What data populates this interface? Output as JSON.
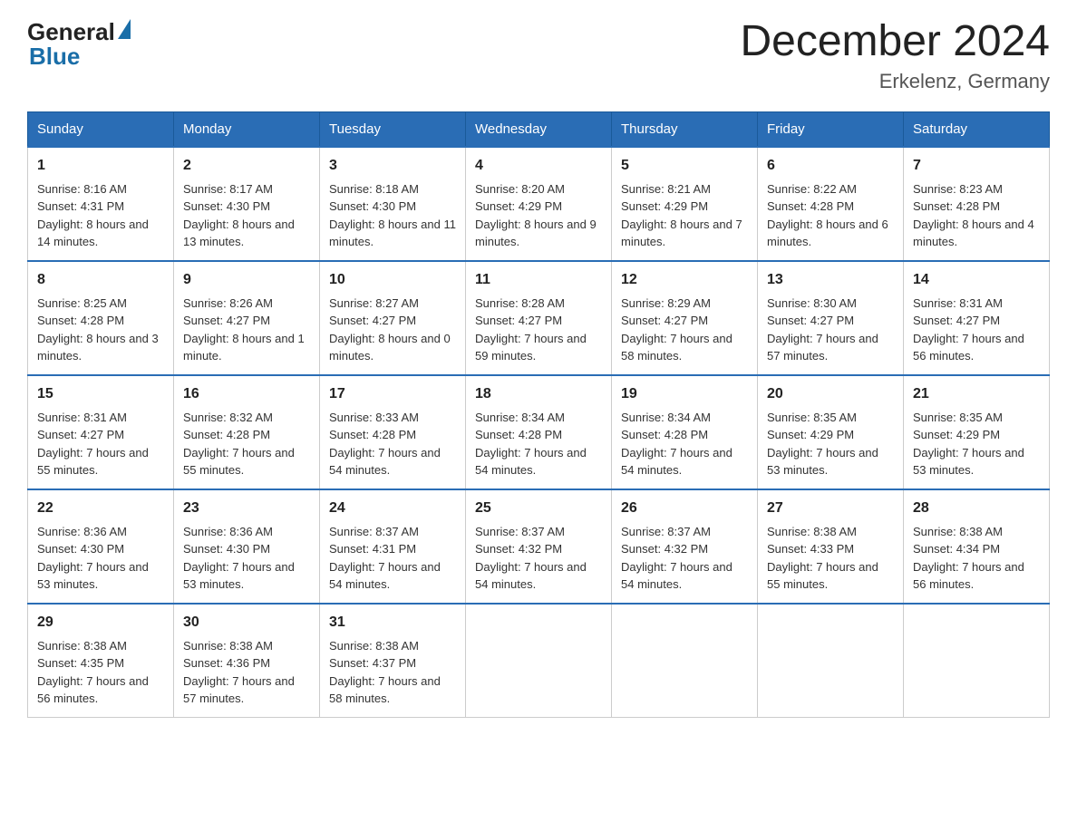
{
  "header": {
    "logo_general": "General",
    "logo_blue": "Blue",
    "title": "December 2024",
    "location": "Erkelenz, Germany"
  },
  "days_of_week": [
    "Sunday",
    "Monday",
    "Tuesday",
    "Wednesday",
    "Thursday",
    "Friday",
    "Saturday"
  ],
  "weeks": [
    [
      {
        "day": "1",
        "sunrise": "8:16 AM",
        "sunset": "4:31 PM",
        "daylight": "8 hours and 14 minutes."
      },
      {
        "day": "2",
        "sunrise": "8:17 AM",
        "sunset": "4:30 PM",
        "daylight": "8 hours and 13 minutes."
      },
      {
        "day": "3",
        "sunrise": "8:18 AM",
        "sunset": "4:30 PM",
        "daylight": "8 hours and 11 minutes."
      },
      {
        "day": "4",
        "sunrise": "8:20 AM",
        "sunset": "4:29 PM",
        "daylight": "8 hours and 9 minutes."
      },
      {
        "day": "5",
        "sunrise": "8:21 AM",
        "sunset": "4:29 PM",
        "daylight": "8 hours and 7 minutes."
      },
      {
        "day": "6",
        "sunrise": "8:22 AM",
        "sunset": "4:28 PM",
        "daylight": "8 hours and 6 minutes."
      },
      {
        "day": "7",
        "sunrise": "8:23 AM",
        "sunset": "4:28 PM",
        "daylight": "8 hours and 4 minutes."
      }
    ],
    [
      {
        "day": "8",
        "sunrise": "8:25 AM",
        "sunset": "4:28 PM",
        "daylight": "8 hours and 3 minutes."
      },
      {
        "day": "9",
        "sunrise": "8:26 AM",
        "sunset": "4:27 PM",
        "daylight": "8 hours and 1 minute."
      },
      {
        "day": "10",
        "sunrise": "8:27 AM",
        "sunset": "4:27 PM",
        "daylight": "8 hours and 0 minutes."
      },
      {
        "day": "11",
        "sunrise": "8:28 AM",
        "sunset": "4:27 PM",
        "daylight": "7 hours and 59 minutes."
      },
      {
        "day": "12",
        "sunrise": "8:29 AM",
        "sunset": "4:27 PM",
        "daylight": "7 hours and 58 minutes."
      },
      {
        "day": "13",
        "sunrise": "8:30 AM",
        "sunset": "4:27 PM",
        "daylight": "7 hours and 57 minutes."
      },
      {
        "day": "14",
        "sunrise": "8:31 AM",
        "sunset": "4:27 PM",
        "daylight": "7 hours and 56 minutes."
      }
    ],
    [
      {
        "day": "15",
        "sunrise": "8:31 AM",
        "sunset": "4:27 PM",
        "daylight": "7 hours and 55 minutes."
      },
      {
        "day": "16",
        "sunrise": "8:32 AM",
        "sunset": "4:28 PM",
        "daylight": "7 hours and 55 minutes."
      },
      {
        "day": "17",
        "sunrise": "8:33 AM",
        "sunset": "4:28 PM",
        "daylight": "7 hours and 54 minutes."
      },
      {
        "day": "18",
        "sunrise": "8:34 AM",
        "sunset": "4:28 PM",
        "daylight": "7 hours and 54 minutes."
      },
      {
        "day": "19",
        "sunrise": "8:34 AM",
        "sunset": "4:28 PM",
        "daylight": "7 hours and 54 minutes."
      },
      {
        "day": "20",
        "sunrise": "8:35 AM",
        "sunset": "4:29 PM",
        "daylight": "7 hours and 53 minutes."
      },
      {
        "day": "21",
        "sunrise": "8:35 AM",
        "sunset": "4:29 PM",
        "daylight": "7 hours and 53 minutes."
      }
    ],
    [
      {
        "day": "22",
        "sunrise": "8:36 AM",
        "sunset": "4:30 PM",
        "daylight": "7 hours and 53 minutes."
      },
      {
        "day": "23",
        "sunrise": "8:36 AM",
        "sunset": "4:30 PM",
        "daylight": "7 hours and 53 minutes."
      },
      {
        "day": "24",
        "sunrise": "8:37 AM",
        "sunset": "4:31 PM",
        "daylight": "7 hours and 54 minutes."
      },
      {
        "day": "25",
        "sunrise": "8:37 AM",
        "sunset": "4:32 PM",
        "daylight": "7 hours and 54 minutes."
      },
      {
        "day": "26",
        "sunrise": "8:37 AM",
        "sunset": "4:32 PM",
        "daylight": "7 hours and 54 minutes."
      },
      {
        "day": "27",
        "sunrise": "8:38 AM",
        "sunset": "4:33 PM",
        "daylight": "7 hours and 55 minutes."
      },
      {
        "day": "28",
        "sunrise": "8:38 AM",
        "sunset": "4:34 PM",
        "daylight": "7 hours and 56 minutes."
      }
    ],
    [
      {
        "day": "29",
        "sunrise": "8:38 AM",
        "sunset": "4:35 PM",
        "daylight": "7 hours and 56 minutes."
      },
      {
        "day": "30",
        "sunrise": "8:38 AM",
        "sunset": "4:36 PM",
        "daylight": "7 hours and 57 minutes."
      },
      {
        "day": "31",
        "sunrise": "8:38 AM",
        "sunset": "4:37 PM",
        "daylight": "7 hours and 58 minutes."
      },
      null,
      null,
      null,
      null
    ]
  ],
  "labels": {
    "sunrise": "Sunrise:",
    "sunset": "Sunset:",
    "daylight": "Daylight:"
  }
}
